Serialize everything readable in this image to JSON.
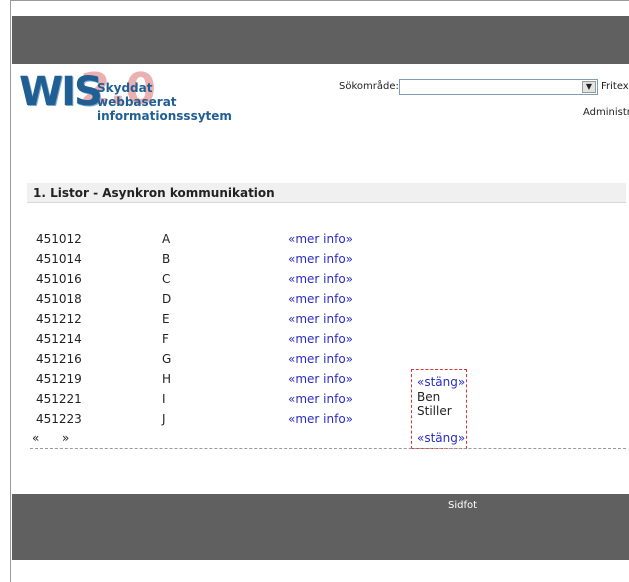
{
  "header": {
    "logo": {
      "main": "WIS",
      "version": "2.0",
      "tag_line1": "Skyddat webbaserat",
      "tag_line2": "informationsssytem"
    },
    "search": {
      "label": "Sökområde:",
      "selected": "",
      "extra_label": "Fritext"
    },
    "admin_link": "Administre"
  },
  "section": {
    "title": "1. Listor - Asynkron kommunikation"
  },
  "list": {
    "more_info_label": "«mer info»",
    "rows": [
      {
        "id": "451012",
        "letter": "A"
      },
      {
        "id": "451014",
        "letter": "B"
      },
      {
        "id": "451016",
        "letter": "C"
      },
      {
        "id": "451018",
        "letter": "D"
      },
      {
        "id": "451212",
        "letter": "E"
      },
      {
        "id": "451214",
        "letter": "F"
      },
      {
        "id": "451216",
        "letter": "G"
      },
      {
        "id": "451219",
        "letter": "H"
      },
      {
        "id": "451221",
        "letter": "I"
      },
      {
        "id": "451223",
        "letter": "J"
      }
    ]
  },
  "pager": {
    "prev": "«",
    "next": "»"
  },
  "popup": {
    "close_label": "«stäng»",
    "line1": "Ben",
    "line2": "Stiller"
  },
  "footer": {
    "text": "Sidfot"
  }
}
